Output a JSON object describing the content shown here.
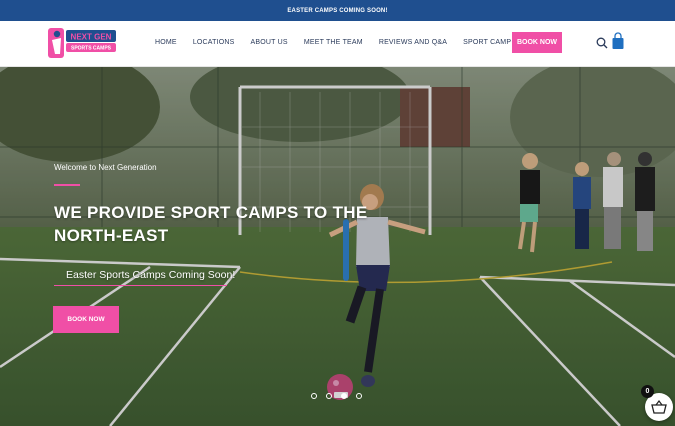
{
  "announcement": "EASTER CAMPS COMING SOON!",
  "logo": {
    "line1": "NEXT GEN",
    "line2": "SPORTS CAMPS"
  },
  "nav": {
    "items": [
      {
        "label": "HOME"
      },
      {
        "label": "LOCATIONS"
      },
      {
        "label": "ABOUT US"
      },
      {
        "label": "MEET THE TEAM"
      },
      {
        "label": "REVIEWS AND Q&A"
      },
      {
        "label": "SPORT CAMP GUIDES"
      }
    ],
    "book_label": "BOOK NOW"
  },
  "hero": {
    "welcome": "Welcome to Next Generation",
    "headline_line1": "WE PROVIDE SPORT CAMPS TO THE",
    "headline_line2": "NORTH-EAST",
    "subline": "Easter Sports Camps Coming Soon!",
    "book_label": "BOOK NOW",
    "slides": 4,
    "active_slide": 3
  },
  "cart": {
    "count": "0"
  },
  "colors": {
    "accent": "#f04fa6",
    "topbar": "#1f4f8f",
    "nav_text": "#2a3a5a",
    "turf": "#4a6a3a"
  },
  "icons": [
    "search-icon",
    "shopping-bag-icon",
    "basket-icon"
  ]
}
